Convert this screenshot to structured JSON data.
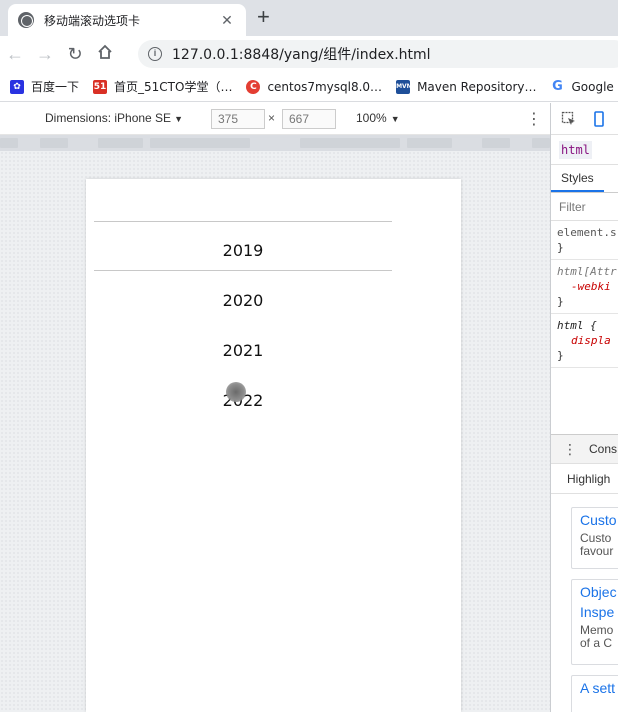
{
  "browser": {
    "tab_title": "移动端滚动选项卡",
    "tab_close": "✕",
    "new_tab": "+",
    "url": "127.0.0.1:8848/yang/组件/index.html",
    "info_glyph": "i"
  },
  "bookmarks": [
    {
      "label": "百度一下",
      "icon": "baidu-icon",
      "color": "#2932e1"
    },
    {
      "label": "首页_51CTO学堂（…",
      "icon": "51cto-icon",
      "color": "#d93025"
    },
    {
      "label": "centos7mysql8.0…",
      "icon": "csdn-icon",
      "color": "#e33e33"
    },
    {
      "label": "Maven Repository…",
      "icon": "maven-icon",
      "color": "#1e4f99"
    },
    {
      "label": "Google",
      "icon": "google-icon",
      "color": "#4285f4"
    }
  ],
  "device_toolbar": {
    "dimensions_label": "Dimensions: iPhone SE",
    "width": "375",
    "height": "667",
    "times": "×",
    "zoom": "100%"
  },
  "picker": {
    "years": [
      "2019",
      "2020",
      "2021",
      "2022"
    ],
    "selected": "2019"
  },
  "devtools": {
    "breadcrumb": "html",
    "tab_styles": "Styles",
    "filter_placeholder": "Filter",
    "rules": [
      {
        "selector": "element.s",
        "props": [],
        "close": "}"
      },
      {
        "selector": "html[Attr",
        "props": [
          "-webki"
        ],
        "close": "}"
      },
      {
        "selector": "html {",
        "props": [
          "displa"
        ],
        "close": "}"
      }
    ],
    "console_label": "Cons",
    "highlights_label": "Highligh",
    "cards": [
      {
        "title": "Custo",
        "desc1": "Custo",
        "desc2": "favour"
      },
      {
        "title": "Objec",
        "subtitle": "Inspe",
        "desc1": "Memo",
        "desc2": "of a C"
      },
      {
        "title": "A sett",
        "desc1": "",
        "desc2": ""
      }
    ]
  }
}
